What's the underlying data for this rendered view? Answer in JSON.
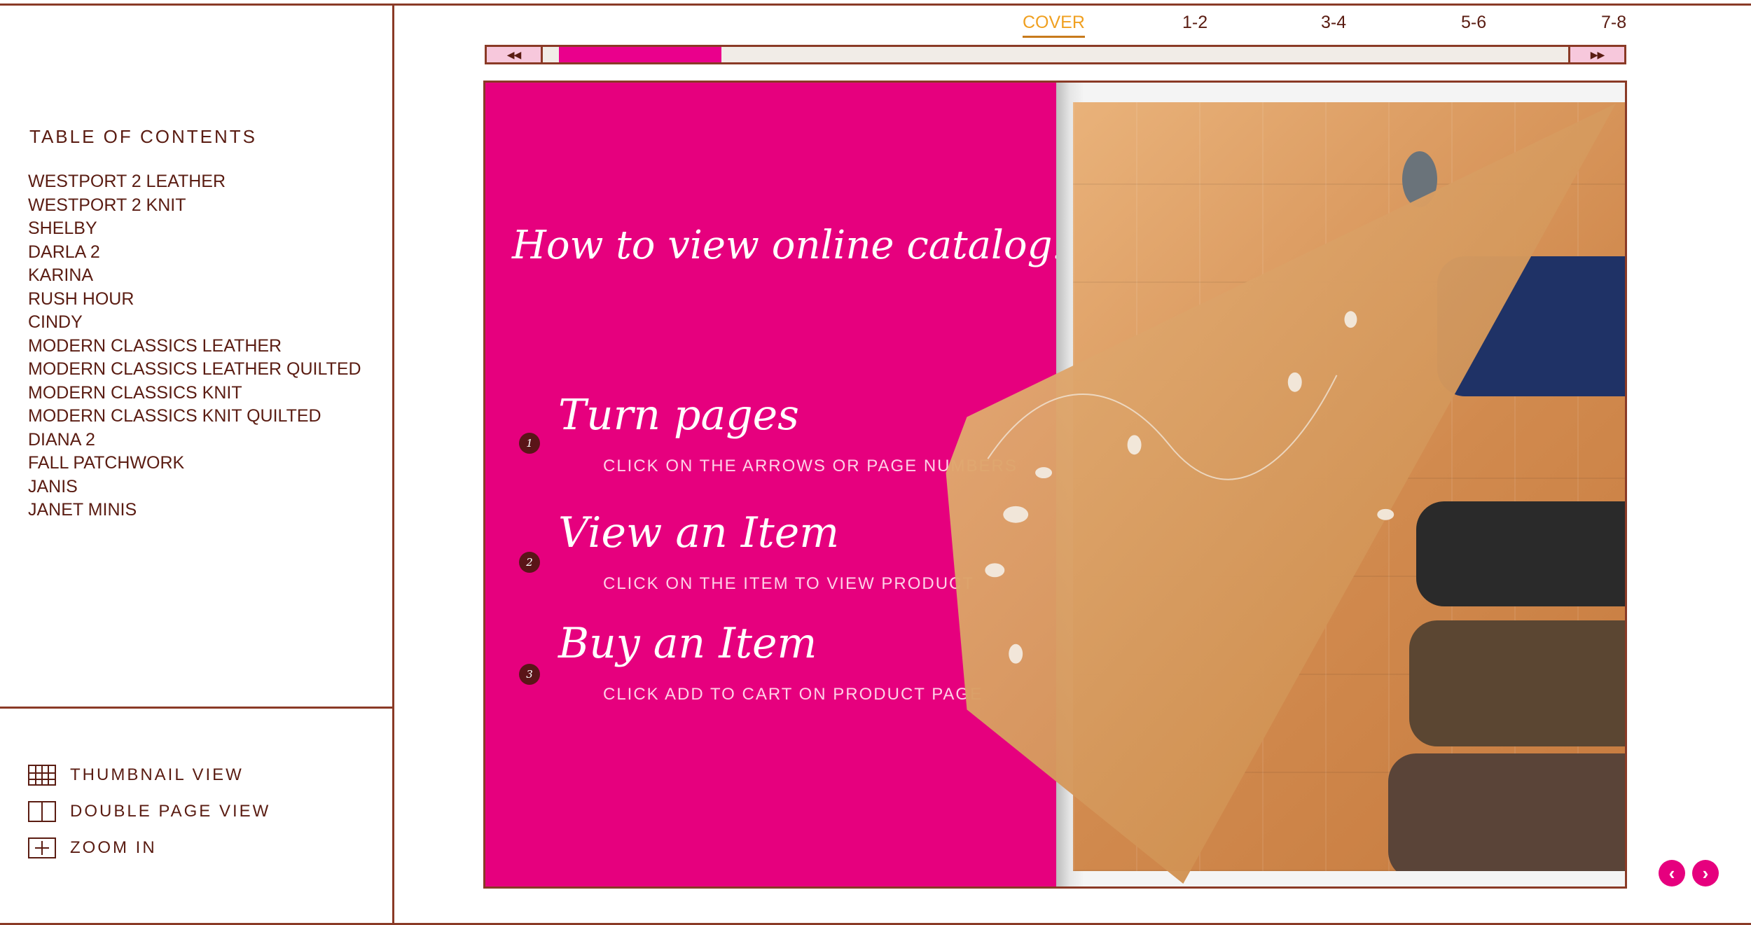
{
  "sidebar": {
    "toc_title": "TABLE OF CONTENTS",
    "toc_items": [
      "WESTPORT 2 LEATHER",
      "WESTPORT 2 KNIT",
      "SHELBY",
      "DARLA 2",
      "KARINA",
      "RUSH HOUR",
      "CINDY",
      "MODERN CLASSICS LEATHER",
      "MODERN CLASSICS LEATHER QUILTED",
      "MODERN CLASSICS KNIT",
      "MODERN CLASSICS KNIT QUILTED",
      "DIANA 2",
      "FALL PATCHWORK",
      "JANIS",
      "JANET MINIS"
    ],
    "view_options": {
      "thumbnail": {
        "label": "THUMBNAIL VIEW",
        "icon": "grid-icon"
      },
      "double": {
        "label": "DOUBLE PAGE VIEW",
        "icon": "double-page-icon"
      },
      "zoom": {
        "label": "ZOOM IN",
        "icon": "zoom-in-icon"
      }
    }
  },
  "page_nav": {
    "tabs": [
      "COVER",
      "1-2",
      "3-4",
      "5-6",
      "7-8"
    ],
    "active": "COVER"
  },
  "scrubber": {
    "prev_label": "◀◀",
    "next_label": "▶▶"
  },
  "left_page": {
    "title": "How to view online catalog:",
    "steps": [
      {
        "num": "1",
        "heading": "Turn pages",
        "sub": "CLICK ON THE ARROWS OR PAGE NUMBERS"
      },
      {
        "num": "2",
        "heading": "View an Item",
        "sub": "CLICK ON THE ITEM TO VIEW PRODUCT"
      },
      {
        "num": "3",
        "heading": "Buy an Item",
        "sub": "CLICK ADD TO CART ON PRODUCT PAGE"
      }
    ]
  },
  "corner_nav": {
    "prev": "‹",
    "next": "›"
  },
  "colors": {
    "accent_pink": "#e6007e",
    "text_brown": "#5a1c12",
    "border_brown": "#8a3a26",
    "active_orange": "#f0a020"
  }
}
